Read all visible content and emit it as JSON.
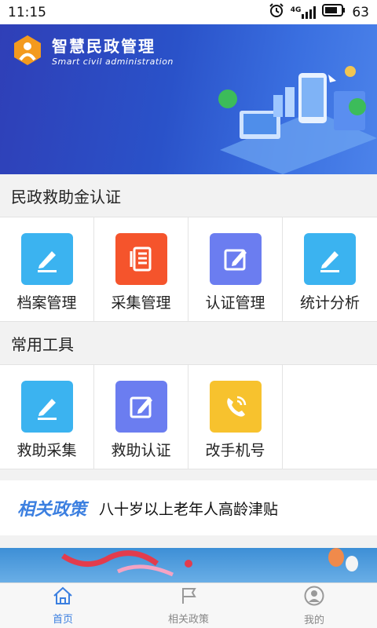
{
  "status": {
    "time": "11:15",
    "network": "4G",
    "battery": "63"
  },
  "brand": {
    "title": "智慧民政管理",
    "subtitle": "Smart civil administration"
  },
  "sections": {
    "relief": {
      "title": "民政救助金认证",
      "items": [
        {
          "label": "档案管理",
          "icon": "pencil-icon",
          "color": "#3bb3f0"
        },
        {
          "label": "采集管理",
          "icon": "document-icon",
          "color": "#f5542c"
        },
        {
          "label": "认证管理",
          "icon": "edit-square-icon",
          "color": "#6b7df0"
        },
        {
          "label": "统计分析",
          "icon": "pencil-icon",
          "color": "#3bb3f0"
        }
      ]
    },
    "tools": {
      "title": "常用工具",
      "items": [
        {
          "label": "救助采集",
          "icon": "pencil-icon",
          "color": "#3bb3f0"
        },
        {
          "label": "救助认证",
          "icon": "edit-square-icon",
          "color": "#6b7df0"
        },
        {
          "label": "改手机号",
          "icon": "phone-icon",
          "color": "#f7c22e"
        }
      ]
    }
  },
  "policy": {
    "tag": "相关政策",
    "headline": "八十岁以上老年人高龄津贴"
  },
  "tabbar": [
    {
      "label": "首页",
      "icon": "home-icon",
      "active": true
    },
    {
      "label": "相关政策",
      "icon": "flag-icon",
      "active": false
    },
    {
      "label": "我的",
      "icon": "user-icon",
      "active": false
    }
  ]
}
